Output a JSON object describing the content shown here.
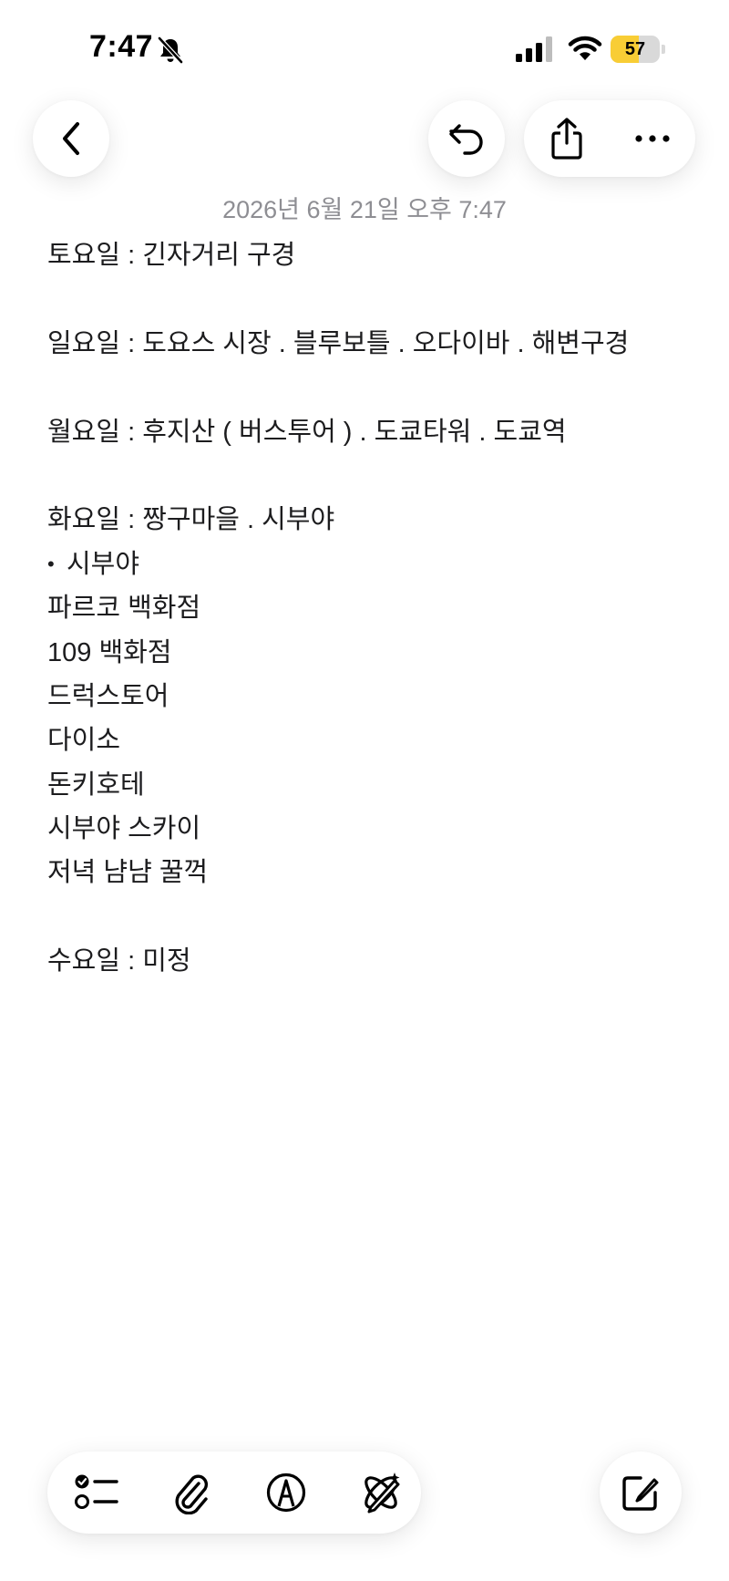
{
  "status_bar": {
    "time": "7:47",
    "battery_level": "57",
    "battery_fraction": 0.57,
    "battery_color": "#f8cd35",
    "icons": [
      "bell-slash-icon",
      "cellular-signal-icon",
      "wifi-icon",
      "battery-icon"
    ]
  },
  "nav": {
    "icons": [
      "chevron-left-icon",
      "undo-icon",
      "share-icon",
      "ellipsis-icon"
    ]
  },
  "note": {
    "date": "2026년 6월 21일 오후 7:47",
    "lines": [
      {
        "text": "토요일 : 긴자거리 구경"
      },
      {
        "text": ""
      },
      {
        "text": "일요일 : 도요스 시장 . 블루보틀 . 오다이바 . 해변구경"
      },
      {
        "text": ""
      },
      {
        "text": "월요일 : 후지산 ( 버스투어 ) . 도쿄타워 . 도쿄역"
      },
      {
        "text": ""
      },
      {
        "text": "화요일 : 짱구마을 . 시부야"
      },
      {
        "text": "시부야",
        "bullet": "•"
      },
      {
        "text": "파르코 백화점"
      },
      {
        "text": "109 백화점"
      },
      {
        "text": "드럭스토어"
      },
      {
        "text": "다이소"
      },
      {
        "text": "돈키호테"
      },
      {
        "text": "시부야 스카이"
      },
      {
        "text": "저녁 냠냠 꿀꺽"
      },
      {
        "text": ""
      },
      {
        "text": "수요일 : 미정"
      }
    ]
  },
  "toolbar": {
    "icons": [
      "checklist-icon",
      "paperclip-icon",
      "markup-pen-icon",
      "writing-tools-icon",
      "compose-icon"
    ]
  }
}
